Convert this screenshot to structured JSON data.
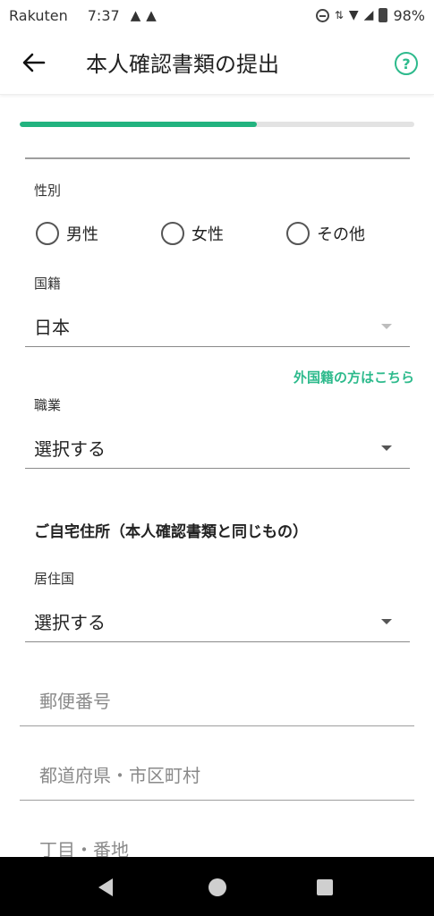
{
  "status_bar": {
    "carrier": "Rakuten",
    "time": "7:37",
    "battery": "98%"
  },
  "app_bar": {
    "title": "本人確認書類の提出",
    "back_icon": "←",
    "help_icon": "?"
  },
  "progress": {
    "fraction": 0.6
  },
  "form": {
    "gender": {
      "label": "性別",
      "options": [
        "男性",
        "女性",
        "その他"
      ]
    },
    "nationality": {
      "label": "国籍",
      "value": "日本"
    },
    "foreign_link": "外国籍の方はこちら",
    "occupation": {
      "label": "職業",
      "value": "選択する"
    },
    "address_section_title": "ご自宅住所（本人確認書類と同じもの）",
    "country_of_residence": {
      "label": "居住国",
      "value": "選択する"
    },
    "postal_code": {
      "placeholder": "郵便番号"
    },
    "prefecture_city": {
      "placeholder": "都道府県・市区町村"
    },
    "street": {
      "placeholder": "丁目・番地"
    }
  },
  "colors": {
    "accent": "#2dba8c",
    "progress_fill": "#22b37f"
  }
}
